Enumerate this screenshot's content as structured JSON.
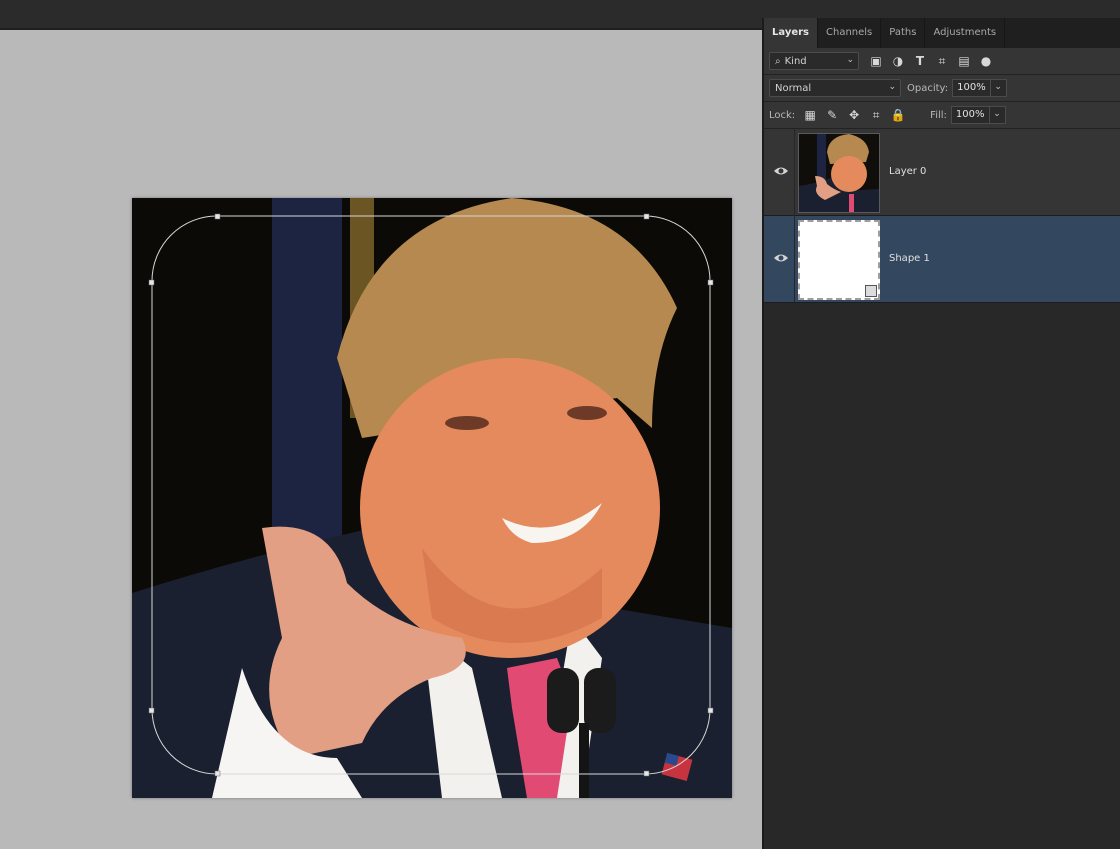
{
  "panel": {
    "tabs": [
      {
        "label": "Layers",
        "active": true
      },
      {
        "label": "Channels"
      },
      {
        "label": "Paths"
      },
      {
        "label": "Adjustments"
      }
    ],
    "filter": {
      "label": "Kind",
      "icons": [
        "image-filter-icon",
        "adjustment-filter-icon",
        "type-filter-icon",
        "shape-filter-icon",
        "smart-object-filter-icon",
        "filter-toggle-icon"
      ]
    },
    "blend_mode": "Normal",
    "opacity_label": "Opacity:",
    "opacity_value": "100%",
    "lock_label": "Lock:",
    "lock_icons": [
      "lock-transparent-icon",
      "lock-paint-icon",
      "lock-position-icon",
      "lock-artboard-icon",
      "lock-all-icon"
    ],
    "fill_label": "Fill:",
    "fill_value": "100%",
    "layers": [
      {
        "name": "Layer 0",
        "visible": true,
        "selected": false
      },
      {
        "name": "Shape 1",
        "visible": true,
        "selected": true
      }
    ]
  },
  "colors": {
    "canvas_bg": "#b9b9b9",
    "panel_bg": "#282828",
    "selected_layer": "#33475f"
  }
}
